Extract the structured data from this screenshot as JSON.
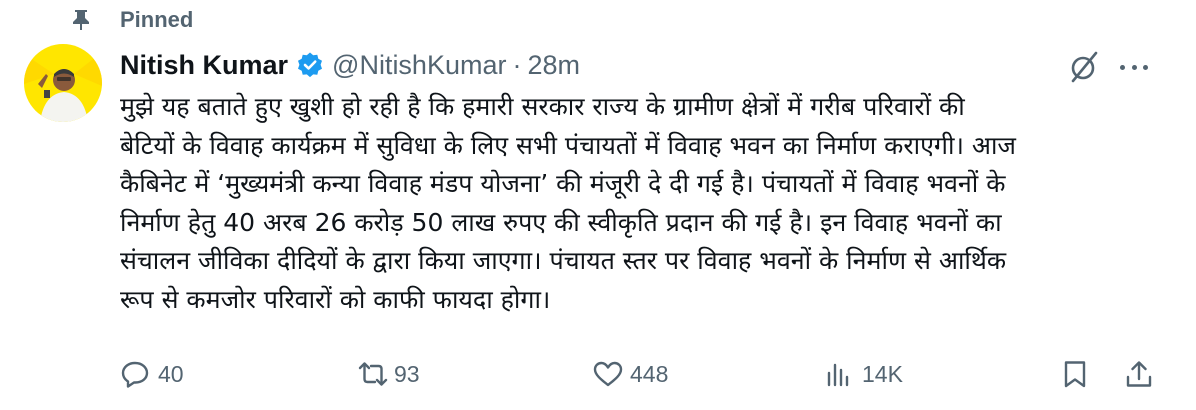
{
  "pinned": {
    "label": "Pinned",
    "icon": "pin-icon"
  },
  "author": {
    "name": "Nitish Kumar",
    "handle": "@NitishKumar",
    "separator": "·",
    "time": "28m",
    "verified_color": "#1d9bf0",
    "avatar_bg": "#ffe600"
  },
  "tweet": {
    "lines": [
      "मुझे यह बताते हुए खुशी हो रही है कि हमारी सरकार राज्य के ग्रामीण क्षेत्रों में गरीब परिवारों की",
      "बेटियों के विवाह कार्यक्रम में सुविधा के लिए सभी पंचायतों में विवाह भवन का निर्माण कराएगी। आज",
      "कैबिनेट में ‘मुख्यमंत्री कन्या विवाह मंडप योजना’ की मंजूरी दे दी गई है। पंचायतों में विवाह भवनों के",
      "निर्माण हेतु 40 अरब 26 करोड़ 50 लाख रुपए की स्वीकृति प्रदान की गई है। इन विवाह भवनों का",
      "संचालन जीविका दीदियों के द्वारा किया जाएगा। पंचायत स्तर पर विवाह भवनों के निर्माण से आर्थिक",
      "रूप से कमजोर परिवारों को काफी फायदा होगा।"
    ]
  },
  "actions": {
    "replies": {
      "count": "40",
      "icon": "reply-icon"
    },
    "reposts": {
      "count": "93",
      "icon": "repost-icon"
    },
    "likes": {
      "count": "448",
      "icon": "like-icon"
    },
    "views": {
      "count": "14K",
      "icon": "views-icon"
    },
    "bookmark": {
      "icon": "bookmark-icon"
    },
    "share": {
      "icon": "share-icon"
    }
  },
  "colors": {
    "text": "#0f1419",
    "secondary": "#536471",
    "accent": "#1d9bf0"
  }
}
